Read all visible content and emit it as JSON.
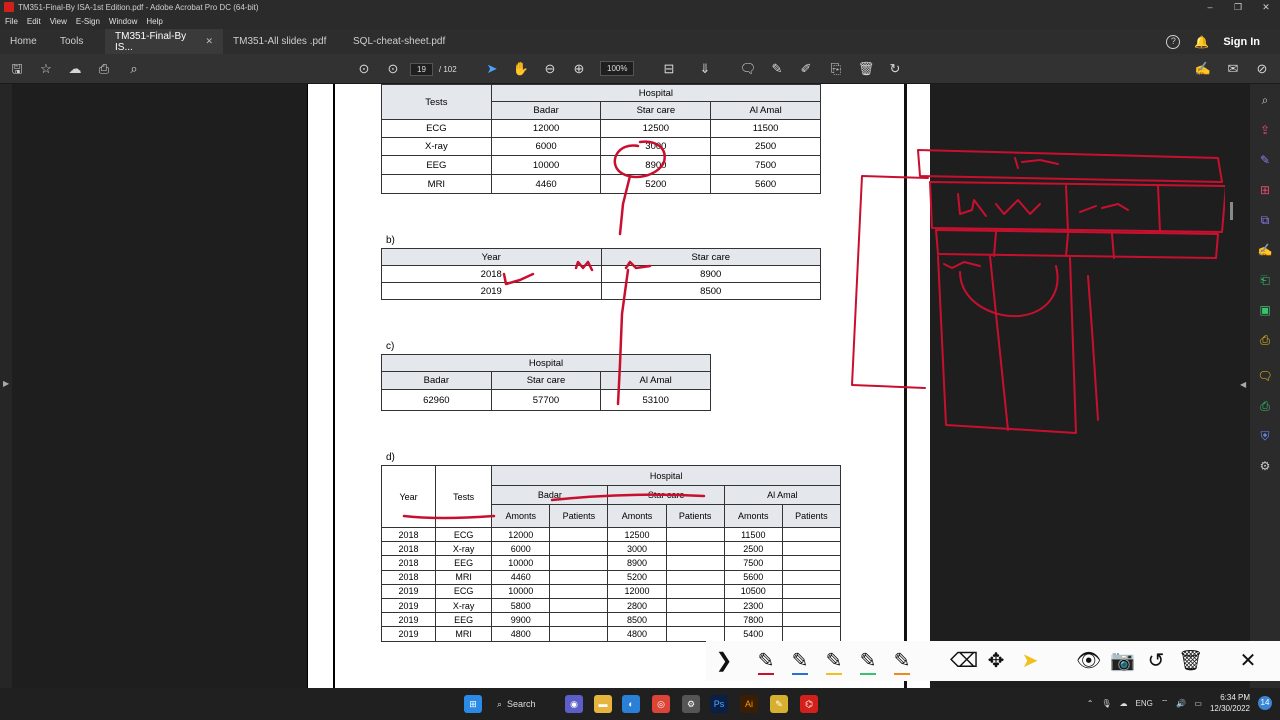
{
  "window": {
    "title": "TM351-Final-By ISA-1st Edition.pdf - Adobe Acrobat Pro DC (64-bit)",
    "controls": [
      "–",
      "❐",
      "✕"
    ]
  },
  "menu": [
    "File",
    "Edit",
    "View",
    "E-Sign",
    "Window",
    "Help"
  ],
  "tabs": {
    "home": "Home",
    "tools": "Tools",
    "docs": [
      {
        "label": "TM351-Final-By IS...",
        "active": true
      },
      {
        "label": "TM351-All slides .pdf",
        "active": false
      },
      {
        "label": "SQL-cheat-sheet.pdf",
        "active": false
      }
    ],
    "help_icon": "?",
    "sign_in": "Sign In"
  },
  "toolbar": {
    "page_current": "19",
    "page_total": "/ 102",
    "zoom": "100%"
  },
  "doc": {
    "table_a": {
      "header_col": "Tests",
      "group_header": "Hospital",
      "hospitals": [
        "Badar",
        "Star care",
        "Al Amal"
      ],
      "rows": [
        [
          "ECG",
          "12000",
          "12500",
          "11500"
        ],
        [
          "X-ray",
          "6000",
          "3000",
          "2500"
        ],
        [
          "EEG",
          "10000",
          "8900",
          "7500"
        ],
        [
          "MRI",
          "4460",
          "5200",
          "5600"
        ]
      ]
    },
    "table_b": {
      "label": "b)",
      "headers": [
        "Year",
        "Star care"
      ],
      "rows": [
        [
          "2018",
          "8900"
        ],
        [
          "2019",
          "8500"
        ]
      ]
    },
    "table_c": {
      "label": "c)",
      "group_header": "Hospital",
      "headers": [
        "Badar",
        "Star care",
        "Al Amal"
      ],
      "values": [
        "62960",
        "57700",
        "53100"
      ]
    },
    "table_d": {
      "label": "d)",
      "col_year": "Year",
      "col_tests": "Tests",
      "group_header": "Hospital",
      "hospitals": [
        "Badar",
        "Star care",
        "Al Amal"
      ],
      "sub_amount": "Amonts",
      "sub_patients": "Patients",
      "rows": [
        [
          "2018",
          "ECG",
          "12000",
          "12500",
          "11500"
        ],
        [
          "2018",
          "X-ray",
          "6000",
          "3000",
          "2500"
        ],
        [
          "2018",
          "EEG",
          "10000",
          "8900",
          "7500"
        ],
        [
          "2018",
          "MRI",
          "4460",
          "5200",
          "5600"
        ],
        [
          "2019",
          "ECG",
          "10000",
          "12000",
          "10500"
        ],
        [
          "2019",
          "X-ray",
          "5800",
          "2800",
          "2300"
        ],
        [
          "2019",
          "EEG",
          "9900",
          "8500",
          "7800"
        ],
        [
          "2019",
          "MRI",
          "4800",
          "4800",
          "5400"
        ]
      ]
    }
  },
  "taskbar": {
    "search": "Search",
    "lang": "ENG",
    "time": "6:34 PM",
    "date": "12/30/2022",
    "notifications": "14"
  },
  "colors": {
    "ink": "#c8102e",
    "acrobat_red": "#d4201a"
  }
}
